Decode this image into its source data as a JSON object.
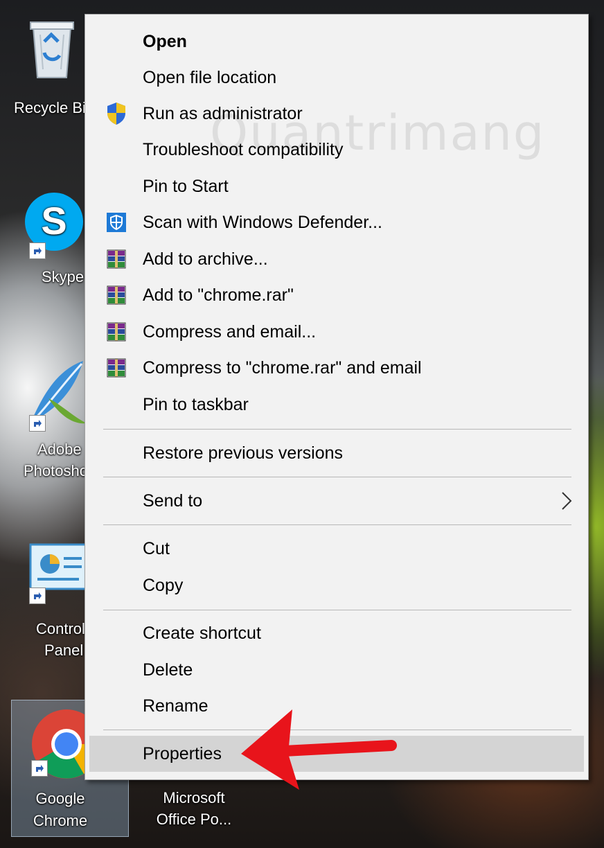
{
  "desktop": {
    "icons": [
      {
        "name": "recycle-bin",
        "lines": [
          "Recycle Bin",
          ""
        ]
      },
      {
        "name": "skype",
        "lines": [
          "Skype",
          ""
        ]
      },
      {
        "name": "adobe-photoshop",
        "lines": [
          "Adobe",
          "Photoshop"
        ]
      },
      {
        "name": "control-panel",
        "lines": [
          "Control",
          "Panel"
        ]
      },
      {
        "name": "google-chrome",
        "lines": [
          "Google",
          "Chrome"
        ]
      },
      {
        "name": "microsoft-office",
        "lines": [
          "Microsoft",
          "Office Po..."
        ]
      }
    ]
  },
  "context_menu": {
    "items": [
      {
        "label": "Open",
        "icon": null
      },
      {
        "label": "Open file location",
        "icon": null
      },
      {
        "label": "Run as administrator",
        "icon": "uac-shield-icon"
      },
      {
        "label": "Troubleshoot compatibility",
        "icon": null
      },
      {
        "label": "Pin to Start",
        "icon": null
      },
      {
        "label": "Scan with Windows Defender...",
        "icon": "windows-defender-icon"
      },
      {
        "label": "Add to archive...",
        "icon": "winrar-icon"
      },
      {
        "label": "Add to \"chrome.rar\"",
        "icon": "winrar-icon"
      },
      {
        "label": "Compress and email...",
        "icon": "winrar-icon"
      },
      {
        "label": "Compress to \"chrome.rar\" and email",
        "icon": "winrar-icon"
      },
      {
        "label": "Pin to taskbar",
        "icon": null
      },
      {
        "label": "Restore previous versions",
        "icon": null
      },
      {
        "label": "Send to",
        "icon": null,
        "submenu": true
      },
      {
        "label": "Cut",
        "icon": null
      },
      {
        "label": "Copy",
        "icon": null
      },
      {
        "label": "Create shortcut",
        "icon": null
      },
      {
        "label": "Delete",
        "icon": null
      },
      {
        "label": "Rename",
        "icon": null
      },
      {
        "label": "Properties",
        "icon": null,
        "highlighted": true
      }
    ]
  },
  "watermark": "Quantrimang",
  "colors": {
    "menu_background": "#f2f2f2",
    "highlight": "#d4d4d4",
    "separator": "#b8b8b8",
    "annotation_arrow": "#e8141b"
  }
}
